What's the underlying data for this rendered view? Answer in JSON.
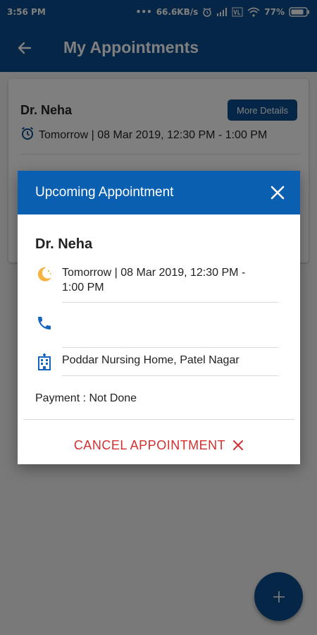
{
  "status_bar": {
    "time": "3:56 PM",
    "dots": "•••",
    "network_speed": "66.6KB/s",
    "battery": "77%",
    "icons": [
      "alarm-icon",
      "signal-icon",
      "volte-icon",
      "wifi-icon",
      "battery-icon"
    ]
  },
  "app_bar": {
    "title": "My Appointments",
    "back_icon": "arrow-back-icon"
  },
  "list": {
    "items": [
      {
        "doctor": "Dr. Neha",
        "time": "Tomorrow | 08 Mar 2019, 12:30 PM - 1:00 PM",
        "more_label": "More Details"
      }
    ],
    "fab_icon": "plus-icon"
  },
  "dialog": {
    "title": "Upcoming Appointment",
    "doctor": "Dr. Neha",
    "time_line1": "Tomorrow | 08 Mar 2019, 12:30 PM -",
    "time_line2": "1:00 PM",
    "phone": "",
    "location": "Poddar Nursing Home, Patel Nagar",
    "payment": "Payment : Not Done",
    "cancel_label": "CANCEL APPOINTMENT"
  },
  "colors": {
    "primary": "#0b4c8c",
    "dialog_header": "#0b5fb0",
    "cancel": "#d32f2f",
    "accent_icon": "#f5b342",
    "icon_blue": "#1565c0"
  }
}
